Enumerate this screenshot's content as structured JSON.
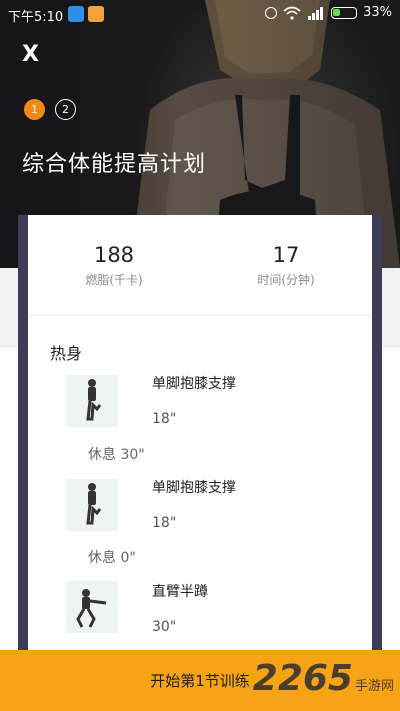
{
  "status_bar": {
    "time": "下午5:10",
    "battery": "33%"
  },
  "header": {
    "close_label": "X",
    "steps": [
      "1",
      "2"
    ],
    "plan_title": "综合体能提高计划"
  },
  "summary": {
    "calories": {
      "value": "188",
      "label": "燃脂(千卡)"
    },
    "duration": {
      "value": "17",
      "label": "时间(分钟)"
    }
  },
  "section_title": "热身",
  "exercises": [
    {
      "name": "单脚抱膝支撑",
      "duration": "18\"",
      "rest": "休息 30\""
    },
    {
      "name": "单脚抱膝支撑",
      "duration": "18\"",
      "rest": "休息 0\""
    },
    {
      "name": "直臂半蹲",
      "duration": "30\""
    }
  ],
  "start_button": "开始第1节训练",
  "watermark": {
    "big": "2265",
    "small": "手游网"
  },
  "colors": {
    "accent": "#f08a14",
    "bottom_bar": "#f6a316",
    "card_frame": "#3d3d56"
  }
}
